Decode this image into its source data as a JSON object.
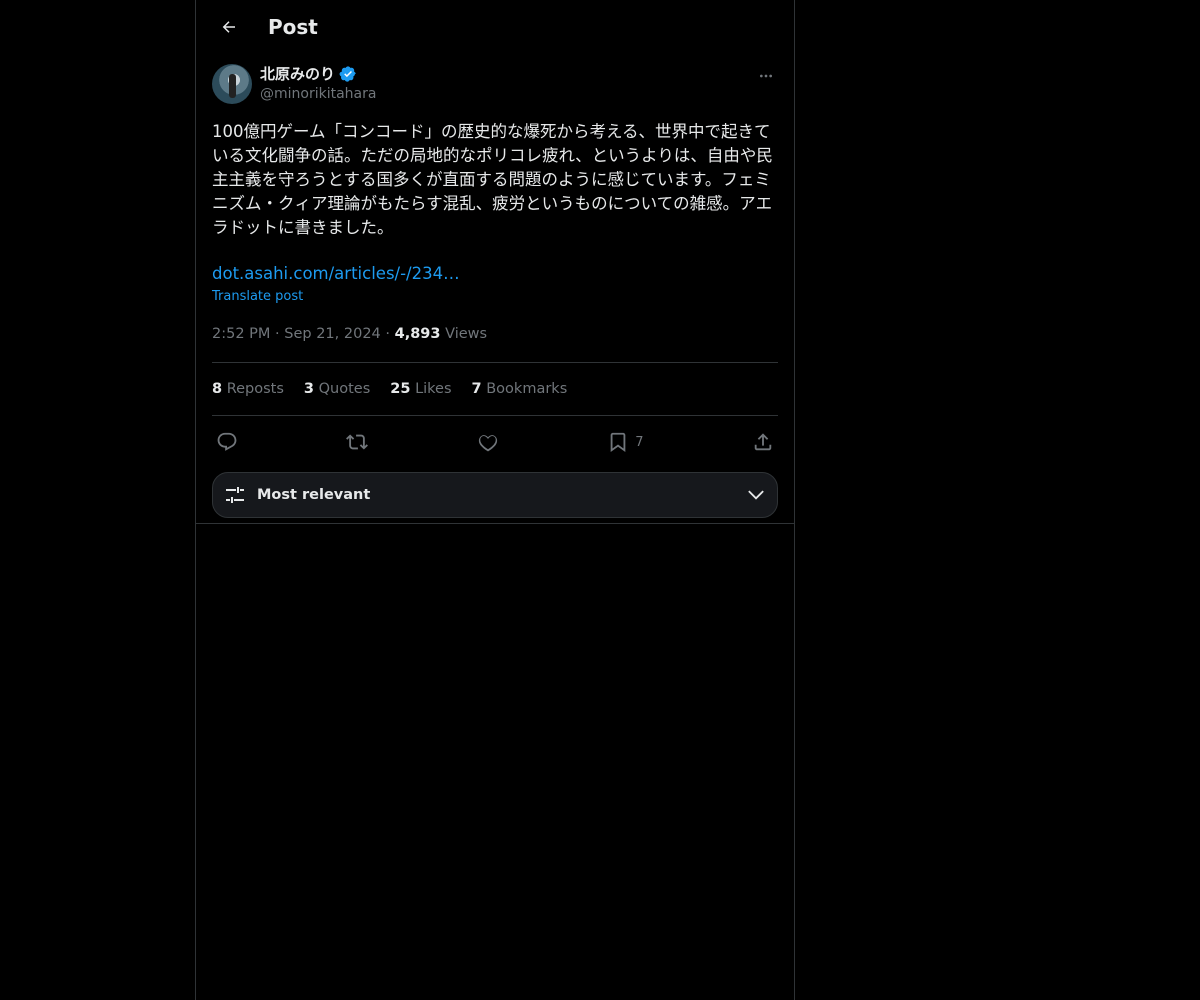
{
  "header": {
    "title": "Post"
  },
  "author": {
    "name": "北原みのり",
    "handle": "@minorikitahara"
  },
  "post": {
    "text": "100億円ゲーム「コンコード」の歴史的な爆死から考える、世界中で起きている文化闘争の話。ただの局地的なポリコレ疲れ、というよりは、自由や民主主義を守ろうとする国多くが直面する問題のように感じています。フェミニズム・クィア理論がもたらす混乱、疲労というものについての雑感。アエラドットに書きました。",
    "link": "dot.asahi.com/articles/-/234…",
    "translate_label": "Translate post",
    "time": "2:52 PM",
    "date": "Sep 21, 2024",
    "views_count": "4,893",
    "views_label": "Views",
    "separator": "·"
  },
  "stats": {
    "reposts_count": "8",
    "reposts_label": "Reposts",
    "quotes_count": "3",
    "quotes_label": "Quotes",
    "likes_count": "25",
    "likes_label": "Likes",
    "bookmarks_count": "7",
    "bookmarks_label": "Bookmarks"
  },
  "actions": {
    "bookmark_count": "7",
    "icons": [
      "reply-icon",
      "repost-icon",
      "like-icon",
      "bookmark-icon",
      "share-icon"
    ]
  },
  "sort": {
    "label": "Most relevant"
  },
  "colors": {
    "background": "#000000",
    "text": "#e7e9ea",
    "muted": "#71767b",
    "accent": "#1d9bf0",
    "border": "#2f3336"
  }
}
